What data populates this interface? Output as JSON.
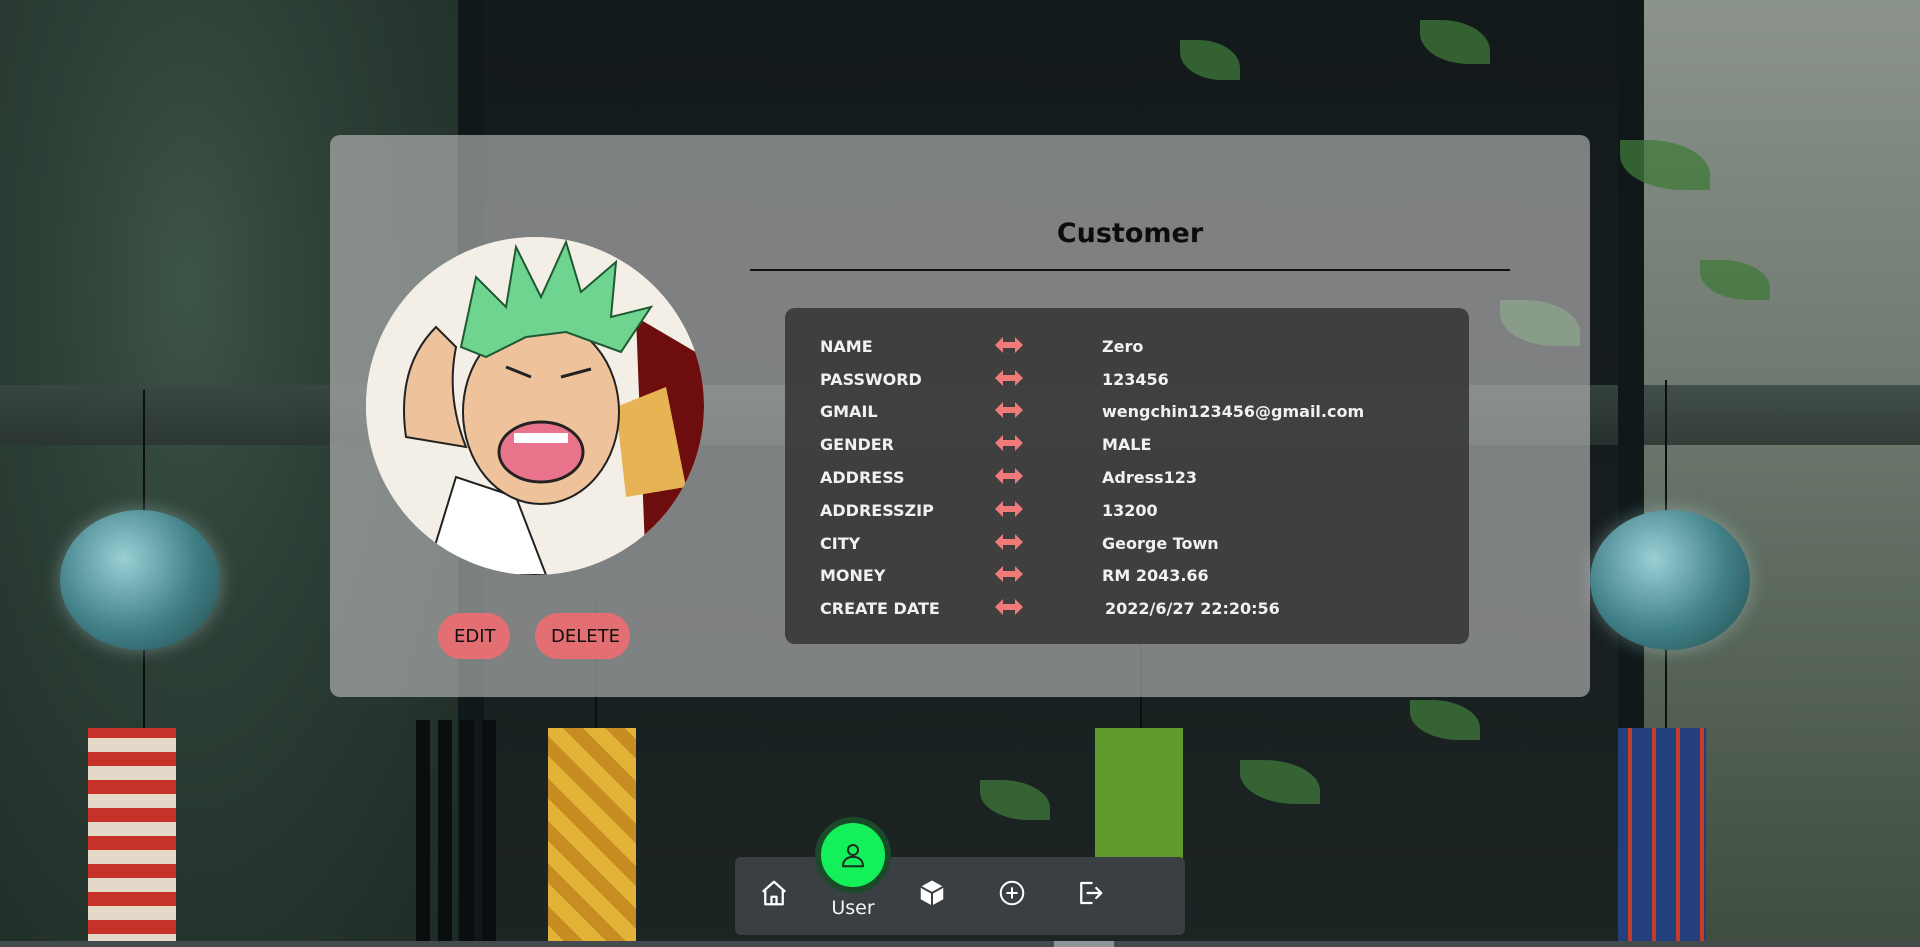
{
  "profile": {
    "title": "Customer",
    "fields": [
      {
        "label": "NAME",
        "value": "Zero"
      },
      {
        "label": "PASSWORD",
        "value": "123456"
      },
      {
        "label": "GMAIL",
        "value": "wengchin123456@gmail.com"
      },
      {
        "label": "GENDER",
        "value": "MALE"
      },
      {
        "label": "ADDRESS",
        "value": "Adress123"
      },
      {
        "label": "ADDRESSZIP",
        "value": "13200"
      },
      {
        "label": "CITY",
        "value": "George Town"
      },
      {
        "label": "MONEY",
        "value": "RM 2043.66"
      },
      {
        "label": "CREATE DATE",
        "value": "2022/6/27 22:20:56"
      }
    ],
    "edit_label": "EDIT",
    "delete_label": "DELETE"
  },
  "nav": {
    "items": [
      {
        "icon": "home-icon"
      },
      {
        "icon": "user-icon",
        "label": "User",
        "active": true
      },
      {
        "icon": "cube-icon"
      },
      {
        "icon": "plus-circle-icon"
      },
      {
        "icon": "logout-icon"
      }
    ]
  },
  "colors": {
    "accent": "#e46f73",
    "active_nav": "#14f05a",
    "arrow": "#f07a7a"
  }
}
